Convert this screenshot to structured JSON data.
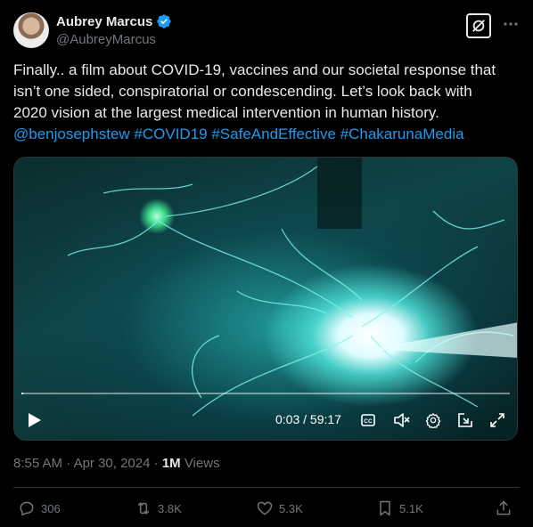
{
  "author": {
    "name": "Aubrey Marcus",
    "handle": "@AubreyMarcus"
  },
  "tweet": {
    "text_lines": [
      "Finally..  a film about COVID-19, vaccines and our societal response that",
      "isn’t one sided, conspiratorial or condescending.  Let’s look back with",
      "2020 vision at the largest medical intervention in human history."
    ],
    "hashtags": [
      "@benjosephstew",
      "#COVID19",
      "#SafeAndEffective",
      "#ChakarunaMedia"
    ]
  },
  "video": {
    "current_time": "0:03",
    "separator": " / ",
    "duration": "59:17",
    "progress_fraction": 0.0008
  },
  "meta": {
    "time": "8:55 AM",
    "dot1": " · ",
    "date": "Apr 30, 2024",
    "dot2": " · ",
    "views_count": "1M",
    "views_label": " Views"
  },
  "actions": {
    "replies": "306",
    "reposts": "3.8K",
    "likes": "5.3K",
    "bookmarks": "5.1K"
  },
  "colors": {
    "accent": "#1d9bf0",
    "text": "#e7e9ea",
    "muted": "#71767b",
    "background": "#000000"
  },
  "icons": {
    "verified": "verified-badge-icon",
    "grok": "grok-icon",
    "more": "more-icon",
    "play": "play-icon",
    "captions": "captions-icon",
    "mute": "mute-icon",
    "settings": "settings-gear-icon",
    "popout": "pop-out-icon",
    "fullscreen": "fullscreen-icon",
    "reply": "reply-icon",
    "repost": "repost-icon",
    "like": "heart-icon",
    "bookmark": "bookmark-icon",
    "share": "share-icon"
  }
}
